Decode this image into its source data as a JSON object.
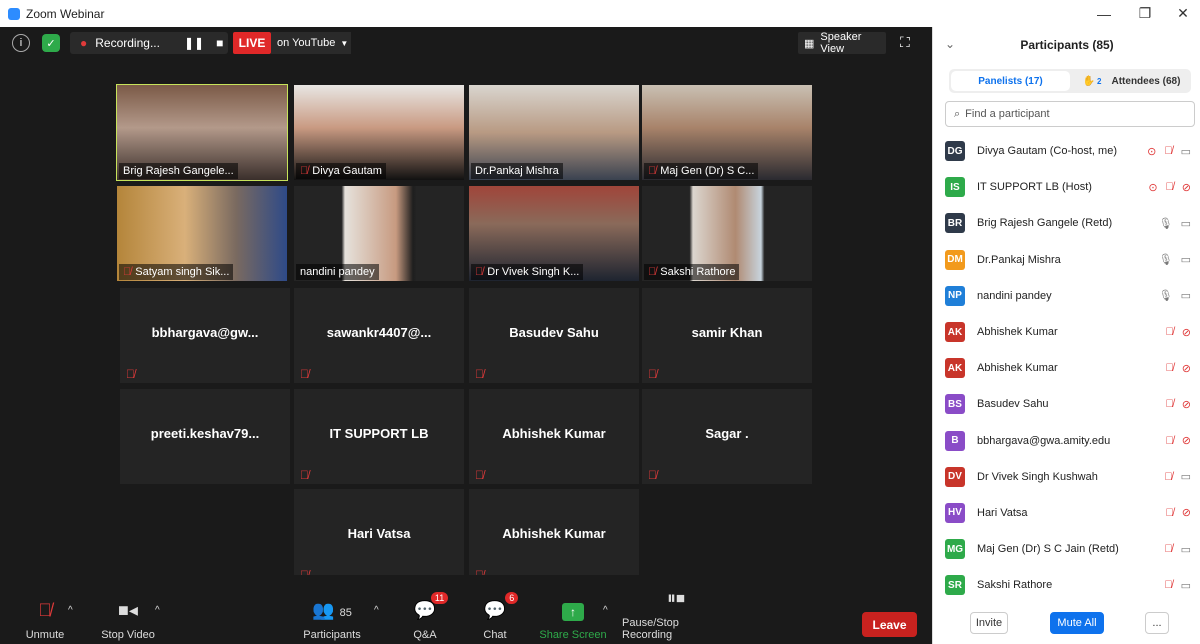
{
  "window": {
    "title": "Zoom Webinar"
  },
  "topbar": {
    "recording_label": "Recording...",
    "live_label": "LIVE",
    "youtube_label": "on YouTube",
    "speaker_view_label": "Speaker View"
  },
  "tiles": [
    {
      "name": "Brig Rajesh Gangele...",
      "video": true,
      "muted": false
    },
    {
      "name": "Divya Gautam",
      "video": true,
      "muted": true
    },
    {
      "name": "Dr.Pankaj Mishra",
      "video": true,
      "muted": false
    },
    {
      "name": "Maj Gen (Dr) S C...",
      "video": true,
      "muted": true
    },
    {
      "name": "Satyam singh Sik...",
      "video": true,
      "muted": true
    },
    {
      "name": "nandini pandey",
      "video": true,
      "muted": false
    },
    {
      "name": "Dr Vivek Singh K...",
      "video": true,
      "muted": true
    },
    {
      "name": "Sakshi Rathore",
      "video": true,
      "muted": true
    },
    {
      "name": "bbhargava@gw...",
      "video": false,
      "muted": true
    },
    {
      "name": "sawankr4407@...",
      "video": false,
      "muted": true
    },
    {
      "name": "Basudev Sahu",
      "video": false,
      "muted": true
    },
    {
      "name": "samir Khan",
      "video": false,
      "muted": true
    },
    {
      "name": "preeti.keshav79...",
      "video": false,
      "muted": false
    },
    {
      "name": "IT SUPPORT LB",
      "video": false,
      "muted": true
    },
    {
      "name": "Abhishek Kumar",
      "video": false,
      "muted": true
    },
    {
      "name": "Sagar .",
      "video": false,
      "muted": true
    },
    {
      "name": "Hari Vatsa",
      "video": false,
      "muted": true
    },
    {
      "name": "Abhishek Kumar",
      "video": false,
      "muted": true
    }
  ],
  "toolbar": {
    "unmute": "Unmute",
    "stop_video": "Stop Video",
    "participants": "Participants",
    "participants_count": "85",
    "qa": "Q&A",
    "qa_badge": "11",
    "chat": "Chat",
    "chat_badge": "6",
    "share_screen": "Share Screen",
    "pause_recording": "Pause/Stop Recording",
    "leave": "Leave"
  },
  "panel": {
    "title": "Participants (85)",
    "tab_panelists": "Panelists (17)",
    "tab_attendees": "Attendees (68)",
    "raised_count": "2",
    "search_placeholder": "Find a participant",
    "participants": [
      {
        "initials": "DG",
        "name": "Divya Gautam (Co-host, me)",
        "color": "#2f3a4a",
        "record": true,
        "mic": "muted",
        "video": "on"
      },
      {
        "initials": "IS",
        "name": "IT SUPPORT LB (Host)",
        "color": "#2eaa4a",
        "record": true,
        "mic": "muted",
        "video": "off"
      },
      {
        "initials": "BR",
        "name": "Brig Rajesh Gangele (Retd)",
        "color": "#2f3a4a",
        "record": false,
        "mic": "on",
        "video": "on"
      },
      {
        "initials": "DM",
        "name": "Dr.Pankaj Mishra",
        "color": "#f29a1c",
        "record": false,
        "mic": "on",
        "video": "on"
      },
      {
        "initials": "NP",
        "name": "nandini pandey",
        "color": "#1f7fd8",
        "record": false,
        "mic": "on",
        "video": "on"
      },
      {
        "initials": "AK",
        "name": "Abhishek Kumar",
        "color": "#c8352a",
        "record": false,
        "mic": "muted",
        "video": "off"
      },
      {
        "initials": "AK",
        "name": "Abhishek Kumar",
        "color": "#c8352a",
        "record": false,
        "mic": "muted",
        "video": "off"
      },
      {
        "initials": "BS",
        "name": "Basudev Sahu",
        "color": "#8a4cc7",
        "record": false,
        "mic": "muted",
        "video": "off"
      },
      {
        "initials": "B",
        "name": "bbhargava@gwa.amity.edu",
        "color": "#8a4cc7",
        "record": false,
        "mic": "muted",
        "video": "off"
      },
      {
        "initials": "DV",
        "name": "Dr Vivek Singh Kushwah",
        "color": "#c8352a",
        "record": false,
        "mic": "muted",
        "video": "on"
      },
      {
        "initials": "HV",
        "name": "Hari Vatsa",
        "color": "#8a4cc7",
        "record": false,
        "mic": "muted",
        "video": "off"
      },
      {
        "initials": "MG",
        "name": "Maj Gen (Dr) S C Jain (Retd)",
        "color": "#2eaa4a",
        "record": false,
        "mic": "muted",
        "video": "on"
      },
      {
        "initials": "SR",
        "name": "Sakshi Rathore",
        "color": "#2eaa4a",
        "record": false,
        "mic": "muted",
        "video": "on"
      }
    ],
    "invite": "Invite",
    "mute_all": "Mute All",
    "more": "..."
  },
  "colors": {
    "accent": "#0e72ed",
    "live": "#e02828",
    "leave": "#c8221f"
  }
}
